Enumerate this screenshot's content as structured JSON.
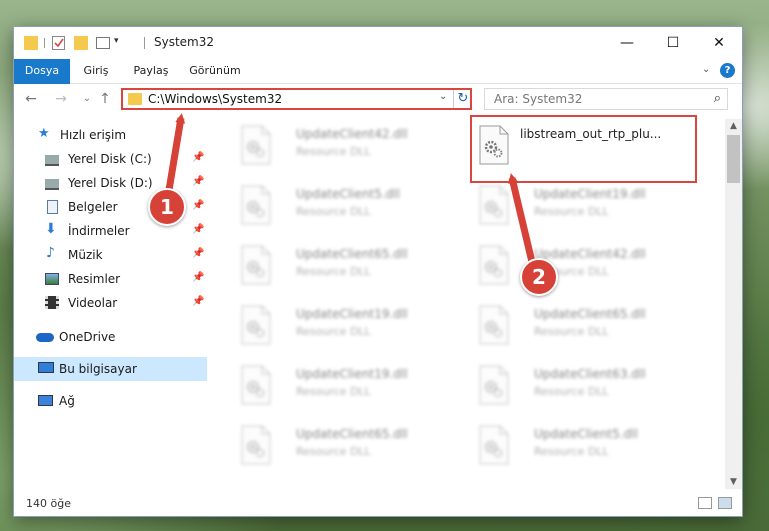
{
  "window": {
    "title": "System32",
    "controls": {
      "minimize": "—",
      "maximize": "☐",
      "close": "✕"
    }
  },
  "ribbon": {
    "tabs": [
      {
        "label": "Dosya"
      },
      {
        "label": "Giriş"
      },
      {
        "label": "Paylaş"
      },
      {
        "label": "Görünüm"
      }
    ],
    "help_icon": "?"
  },
  "address": {
    "path": "C:\\Windows\\System32",
    "dropdown": "⌄",
    "refresh": "↻"
  },
  "search": {
    "placeholder": "Ara: System32",
    "icon": "⌕"
  },
  "nav": {
    "back": "←",
    "forward": "→",
    "recent": "⌄",
    "up": "↑"
  },
  "sidebar": {
    "quick_access": "Hızlı erişim",
    "items": [
      {
        "label": "Yerel Disk (C:)",
        "pinned": true
      },
      {
        "label": "Yerel Disk (D:)",
        "pinned": true
      },
      {
        "label": "Belgeler",
        "pinned": true
      },
      {
        "label": "İndirmeler",
        "pinned": true
      },
      {
        "label": "Müzik",
        "pinned": true
      },
      {
        "label": "Resimler",
        "pinned": true
      },
      {
        "label": "Videolar",
        "pinned": true
      }
    ],
    "onedrive": "OneDrive",
    "this_pc": "Bu bilgisayar",
    "network": "Ağ"
  },
  "files": {
    "highlighted": {
      "name": "libstream_out_rtp_plu...",
      "type": ""
    },
    "left_column": [
      {
        "name": "UpdateClient42.dll",
        "type": "Resource DLL"
      },
      {
        "name": "UpdateClient5.dll",
        "type": "Resource DLL"
      },
      {
        "name": "UpdateClient65.dll",
        "type": "Resource DLL"
      },
      {
        "name": "UpdateClient19.dll",
        "type": "Resource DLL"
      },
      {
        "name": "UpdateClient19.dll",
        "type": "Resource DLL"
      },
      {
        "name": "UpdateClient65.dll",
        "type": "Resource DLL"
      }
    ],
    "right_column": [
      {
        "name": "UpdateClient19.dll",
        "type": "Resource DLL"
      },
      {
        "name": "UpdateClient42.dll",
        "type": "Resource DLL"
      },
      {
        "name": "UpdateClient65.dll",
        "type": "Resource DLL"
      },
      {
        "name": "UpdateClient63.dll",
        "type": "Resource DLL"
      },
      {
        "name": "UpdateClient5.dll",
        "type": "Resource DLL"
      }
    ]
  },
  "status": {
    "item_count": "140 öğe"
  },
  "annotations": {
    "step1": "1",
    "step2": "2",
    "color": "#d64238"
  }
}
